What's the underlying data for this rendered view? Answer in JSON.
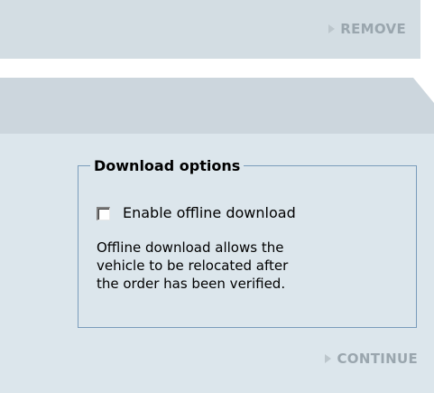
{
  "top_bar": {
    "remove_label": "REMOVE"
  },
  "download_options": {
    "legend": "Download options",
    "checkbox_label": "Enable offline download",
    "checked": false,
    "description_lines": [
      "Offline download allows the",
      "vehicle to be relocated after",
      "the order has been verified."
    ]
  },
  "footer": {
    "continue_label": "CONTINUE"
  },
  "colors": {
    "bar_bg": "#d3dde3",
    "panel_header": "#ccd6dd",
    "panel_body": "#dce6ec",
    "border": "#7a9cbb",
    "disabled_text": "#9aa6ae"
  }
}
